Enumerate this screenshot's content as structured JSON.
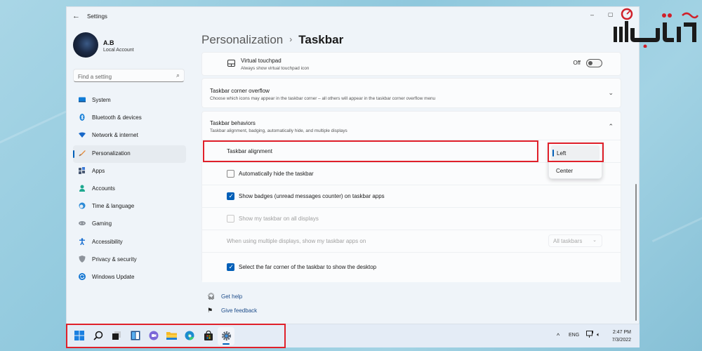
{
  "window": {
    "title": "Settings",
    "back_icon": "arrow-left-icon",
    "controls": {
      "minimize": "–",
      "maximize": "▢"
    }
  },
  "user": {
    "name": "A.B",
    "account_type": "Local Account"
  },
  "search": {
    "placeholder": "Find a setting",
    "value": ""
  },
  "sidebar": {
    "items": [
      {
        "label": "System",
        "icon": "monitor-icon",
        "color": "#0f7bd6"
      },
      {
        "label": "Bluetooth & devices",
        "icon": "bluetooth-icon",
        "color": "#0f7bd6"
      },
      {
        "label": "Network & internet",
        "icon": "wifi-icon",
        "color": "#1868c8"
      },
      {
        "label": "Personalization",
        "icon": "brush-icon",
        "color": "#e38b3a",
        "active": true
      },
      {
        "label": "Apps",
        "icon": "apps-icon",
        "color": "#4a5a74"
      },
      {
        "label": "Accounts",
        "icon": "person-icon",
        "color": "#1da88f"
      },
      {
        "label": "Time & language",
        "icon": "globe-clock-icon",
        "color": "#2a8ad6"
      },
      {
        "label": "Gaming",
        "icon": "gamepad-icon",
        "color": "#8a9099"
      },
      {
        "label": "Accessibility",
        "icon": "accessibility-icon",
        "color": "#1a6fd1"
      },
      {
        "label": "Privacy & security",
        "icon": "shield-icon",
        "color": "#8d939b"
      },
      {
        "label": "Windows Update",
        "icon": "update-icon",
        "color": "#1677d2"
      }
    ]
  },
  "breadcrumb": {
    "parent": "Personalization",
    "separator": "›",
    "current": "Taskbar"
  },
  "virtual_touchpad": {
    "title": "Virtual touchpad",
    "subtitle": "Always show virtual touchpad icon",
    "toggle_state": "Off",
    "toggle_on": false
  },
  "corner_overflow": {
    "title": "Taskbar corner overflow",
    "subtitle": "Choose which icons may appear in the taskbar corner – all others will appear in the taskbar corner overflow menu",
    "expanded": false
  },
  "behaviors": {
    "title": "Taskbar behaviors",
    "subtitle": "Taskbar alignment, badging, automatically hide, and multiple displays",
    "expanded": true,
    "alignment": {
      "label": "Taskbar alignment",
      "options": [
        "Left",
        "Center"
      ],
      "selected": "Left"
    },
    "auto_hide": {
      "label": "Automatically hide the taskbar",
      "checked": false,
      "disabled": false
    },
    "badges": {
      "label": "Show badges (unread messages counter) on taskbar apps",
      "checked": true,
      "disabled": false
    },
    "all_displays": {
      "label": "Show my taskbar on all displays",
      "checked": false,
      "disabled": true
    },
    "multi_display": {
      "label": "When using multiple displays, show my taskbar apps on",
      "value": "All taskbars",
      "disabled": true
    },
    "far_corner": {
      "label": "Select the far corner of the taskbar to show the desktop",
      "checked": true,
      "disabled": false
    }
  },
  "links": {
    "get_help": "Get help",
    "give_feedback": "Give feedback"
  },
  "taskbar": {
    "apps": [
      {
        "name": "start",
        "icon": "windows-start-icon"
      },
      {
        "name": "search",
        "icon": "search-icon"
      },
      {
        "name": "task-view",
        "icon": "task-view-icon"
      },
      {
        "name": "widgets",
        "icon": "widgets-icon"
      },
      {
        "name": "chat",
        "icon": "teams-chat-icon"
      },
      {
        "name": "file-explorer",
        "icon": "folder-icon"
      },
      {
        "name": "edge",
        "icon": "edge-browser-icon"
      },
      {
        "name": "store",
        "icon": "store-bag-icon"
      },
      {
        "name": "settings",
        "icon": "gear-icon",
        "active": true
      }
    ],
    "tray": {
      "chevron": "^",
      "language": "ENG",
      "time": "2:47 PM",
      "date": "7/3/2022"
    }
  },
  "colors": {
    "accent": "#005fb8",
    "highlight": "#e0202a"
  }
}
